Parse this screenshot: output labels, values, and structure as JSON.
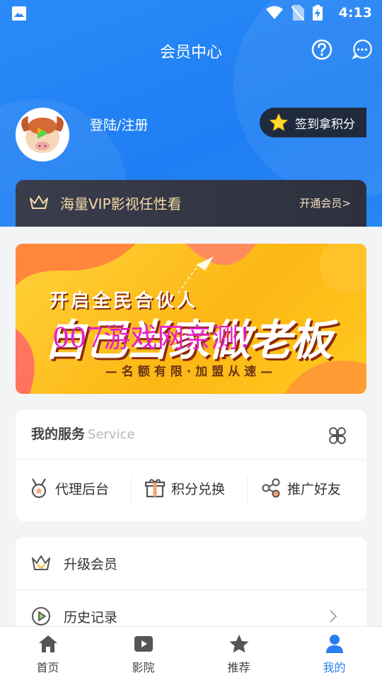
{
  "status_bar": {
    "time": "4:13"
  },
  "header": {
    "title": "会员中心"
  },
  "user": {
    "login_label": "登陆/注册",
    "checkin_label": "签到拿积分"
  },
  "vip": {
    "text": "海量VIP影视任性看",
    "open_label": "开通会员>"
  },
  "banner": {
    "line1": "开启全民合伙人",
    "line2": "自己当家做老板",
    "watermark": "007游戏网亲测！",
    "line3": "—名额有限·加盟从速—"
  },
  "services": {
    "title": "我的服务",
    "subtitle": "Service",
    "items": [
      {
        "label": "代理后台",
        "icon": "medal-icon"
      },
      {
        "label": "积分兑换",
        "icon": "gift-icon"
      },
      {
        "label": "推广好友",
        "icon": "share-icon"
      }
    ]
  },
  "menu": {
    "items": [
      {
        "label": "升级会员",
        "icon": "crown-icon"
      },
      {
        "label": "历史记录",
        "icon": "play-circle-icon"
      }
    ]
  },
  "tabbar": {
    "items": [
      {
        "label": "首页",
        "icon": "home-icon"
      },
      {
        "label": "影院",
        "icon": "video-icon"
      },
      {
        "label": "推荐",
        "icon": "star-icon"
      },
      {
        "label": "我的",
        "icon": "user-icon",
        "active": true
      }
    ]
  },
  "colors": {
    "primary": "#1e7ef3",
    "vip_gold": "#f4d9a6",
    "active_tab": "#2a7ff0"
  }
}
